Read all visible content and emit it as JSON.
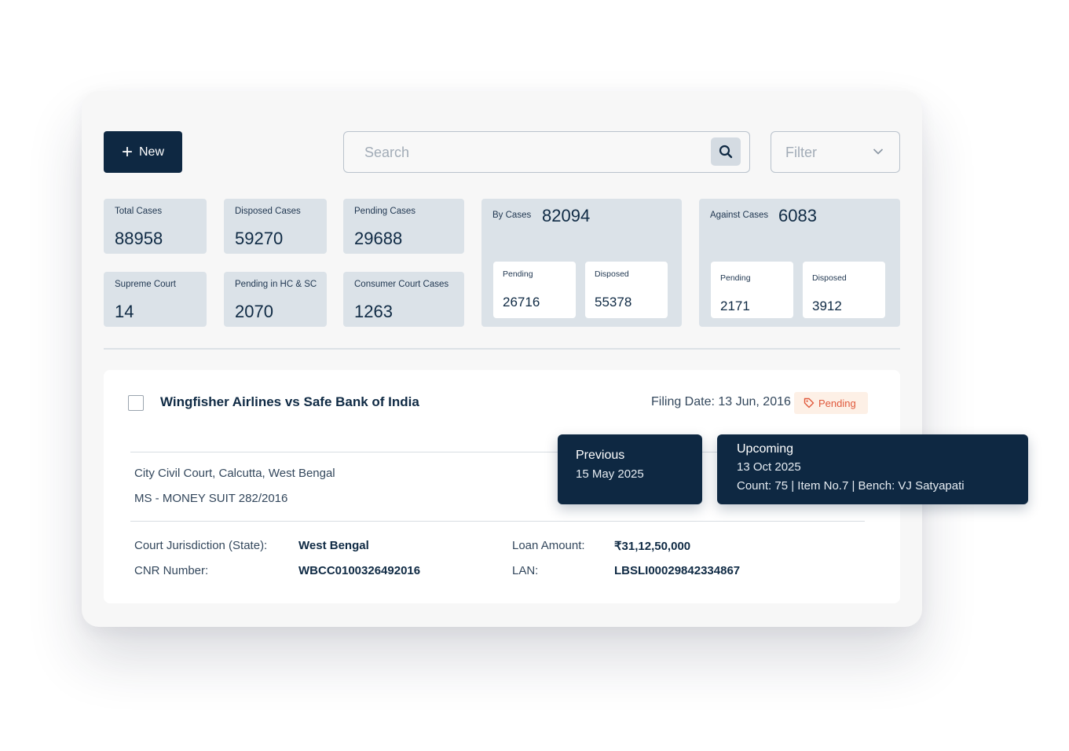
{
  "toolbar": {
    "new_label": "New",
    "search_placeholder": "Search",
    "filter_label": "Filter"
  },
  "stats": {
    "total_cases": {
      "label": "Total Cases",
      "value": "88958"
    },
    "disposed_cases": {
      "label": "Disposed Cases",
      "value": "59270"
    },
    "pending_cases": {
      "label": "Pending Cases",
      "value": "29688"
    },
    "supreme_court": {
      "label": "Supreme Court",
      "value": "14"
    },
    "pending_hc_sc": {
      "label": "Pending in HC & SC",
      "value": "2070"
    },
    "consumer_court": {
      "label": "Consumer Court Cases",
      "value": "1263"
    },
    "by_cases": {
      "label": "By Cases",
      "value": "82094",
      "pending_label": "Pending",
      "pending_value": "26716",
      "disposed_label": "Disposed",
      "disposed_value": "55378"
    },
    "against_cases": {
      "label": "Against Cases",
      "value": "6083",
      "pending_label": "Pending",
      "pending_value": "2171",
      "disposed_label": "Disposed",
      "disposed_value": "3912"
    }
  },
  "case": {
    "title": "Wingfisher Airlines vs Safe Bank of India",
    "filing_date": "Filing Date: 13 Jun, 2016",
    "status": "Pending",
    "status_color": "#e0583b",
    "court": "City Civil Court, Calcutta, West Bengal",
    "suit": "MS - MONEY SUIT 282/2016",
    "jurisdiction_label": "Court Jurisdiction (State):",
    "jurisdiction_value": "West Bengal",
    "cnr_label": "CNR Number:",
    "cnr_value": "WBCC0100326492016",
    "loan_label": "Loan Amount:",
    "loan_value": "₹31,12,50,000",
    "lan_label": "LAN:",
    "lan_value": "LBSLI00029842334867"
  },
  "hearings": {
    "previous": {
      "title": "Previous",
      "date": "15 May 2025"
    },
    "upcoming": {
      "title": "Upcoming",
      "date": "13 Oct 2025",
      "details": "Count: 75 | Item No.7 | Bench: VJ Satyapati"
    }
  },
  "colors": {
    "primary": "#0e2842",
    "card_bg": "#dbe2e8"
  }
}
